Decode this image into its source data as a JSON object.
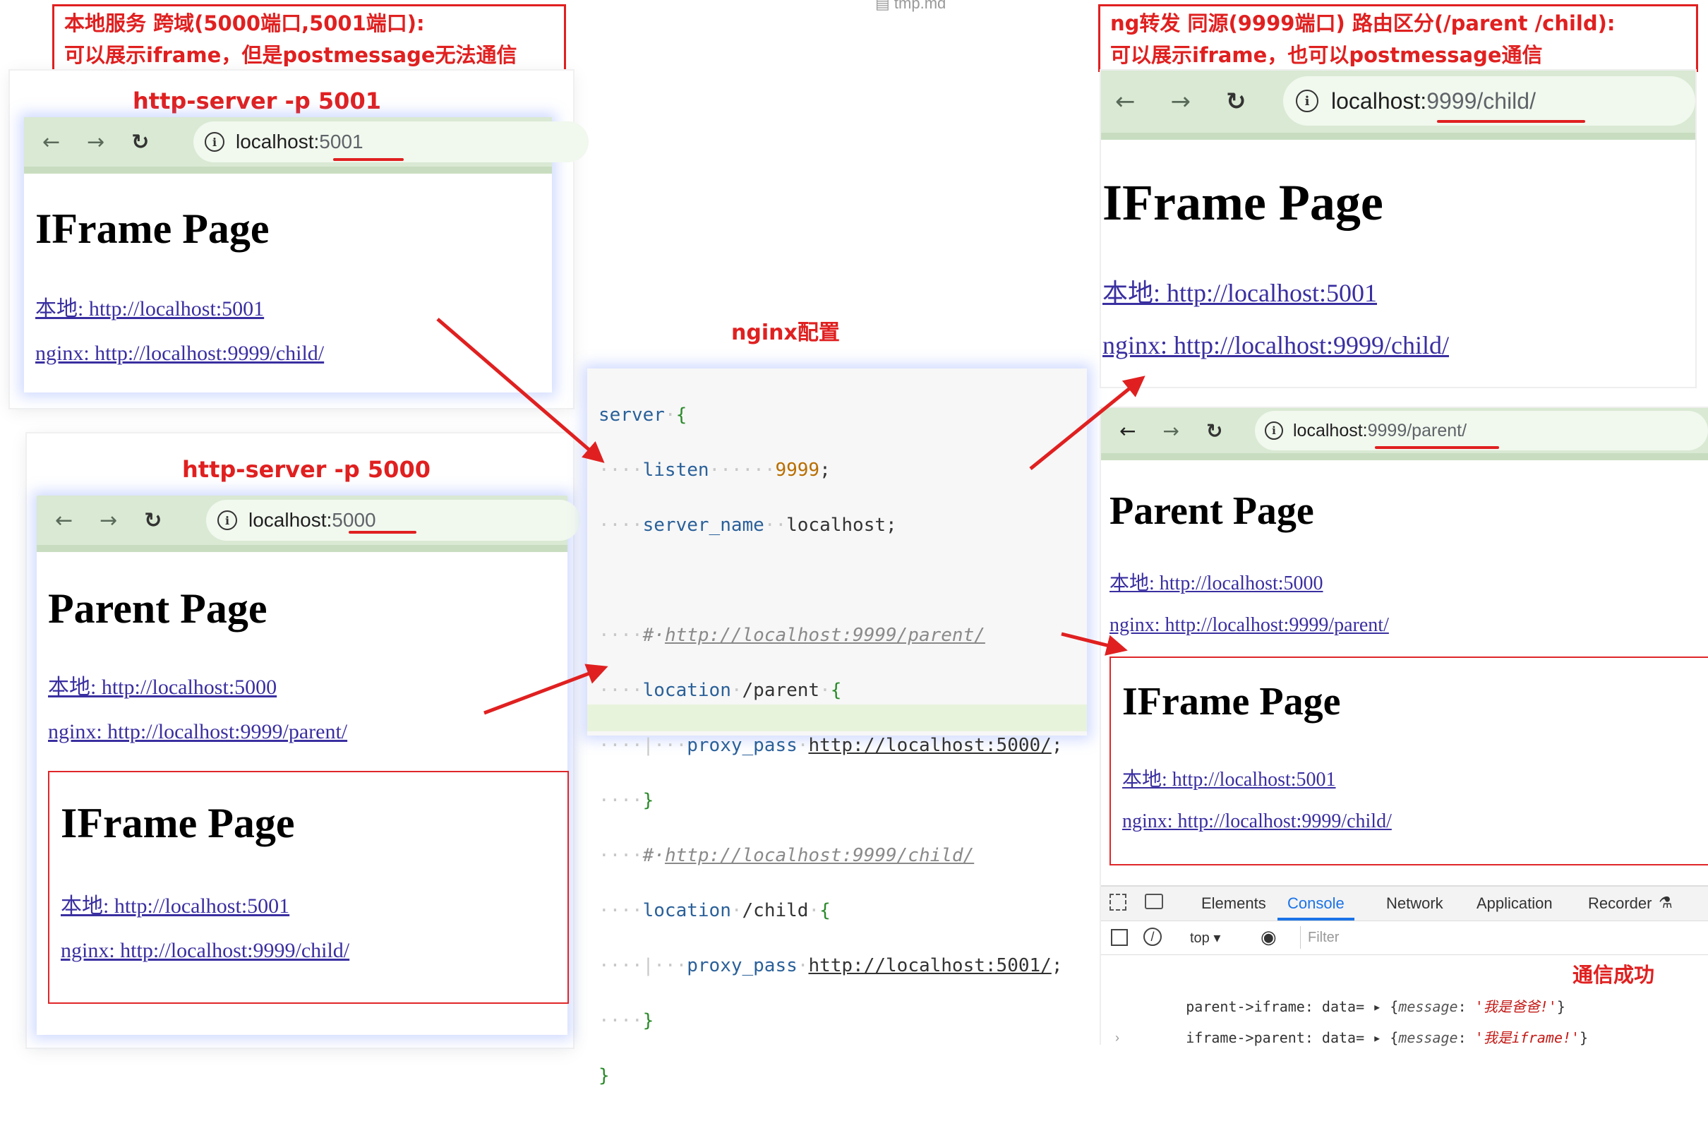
{
  "file_tab": "tmp.md",
  "notes": {
    "left_line1": "本地服务 跨域(5000端口,5001端口):",
    "left_line2": "可以展示iframe，但是postmessage无法通信",
    "right_line1": "ng转发 同源(9999端口) 路由区分(/parent /child):",
    "right_line2": "可以展示iframe，也可以postmessage通信",
    "nginx_label": "nginx配置",
    "success_label": "通信成功"
  },
  "server_labels": {
    "s5001": "http-server -p 5001",
    "s5000": "http-server -p 5000"
  },
  "nav_icons": {
    "back": "←",
    "forward": "→",
    "reload": "↻",
    "info": "i"
  },
  "url_host": "localhost:",
  "browsers": {
    "b5001": {
      "port": "5001",
      "title": "IFrame Page",
      "link_local": "本地: http://localhost:5001",
      "link_nginx": "nginx: http://localhost:9999/child/"
    },
    "b5000": {
      "port": "5000",
      "title": "Parent Page",
      "link_local": "本地: http://localhost:5000",
      "link_nginx": "nginx: http://localhost:9999/parent/",
      "iframe": {
        "title": "IFrame Page",
        "link_local": "本地: http://localhost:5001",
        "link_nginx": "nginx: http://localhost:9999/child/"
      }
    },
    "child": {
      "port": "9999/child/",
      "title": "IFrame Page",
      "link_local": "本地: http://localhost:5001",
      "link_nginx": "nginx: http://localhost:9999/child/"
    },
    "parent": {
      "port": "9999/parent/",
      "title": "Parent Page",
      "link_local": "本地: http://localhost:5000",
      "link_nginx": "nginx: http://localhost:9999/parent/",
      "iframe": {
        "title": "IFrame Page",
        "link_local": "本地: http://localhost:5001",
        "link_nginx": "nginx: http://localhost:9999/child/"
      }
    }
  },
  "nginx_code": {
    "l1": "server",
    "l2_kw": "listen",
    "l2_val": "9999",
    "l3_kw": "server_name",
    "l3_val": "localhost;",
    "l5_cmt": "http://localhost:9999/parent/",
    "l6_kw": "location",
    "l6_path": "/parent",
    "l7_kw": "proxy_pass",
    "l7_url": "http://localhost:5000/",
    "l9_cmt": "http://localhost:9999/child/",
    "l10_kw": "location",
    "l10_path": "/child",
    "l11_kw": "proxy_pass",
    "l11_url": "http://localhost:5001/"
  },
  "devtools": {
    "tabs": [
      "Elements",
      "Console",
      "Network",
      "Application",
      "Recorder"
    ],
    "active_tab": "Console",
    "context": "top",
    "filter_placeholder": "Filter",
    "console": [
      {
        "prefix": "parent->iframe: data=",
        "key": "message",
        "value": "'我是爸爸!'"
      },
      {
        "prefix": "iframe->parent: data=",
        "key": "message",
        "value": "'我是iframe!'"
      }
    ]
  },
  "colors": {
    "annotation": "#e02020",
    "chrome_bar": "#d9e9d3",
    "link": "#3a2fa0",
    "active_tab": "#1a73e8"
  }
}
